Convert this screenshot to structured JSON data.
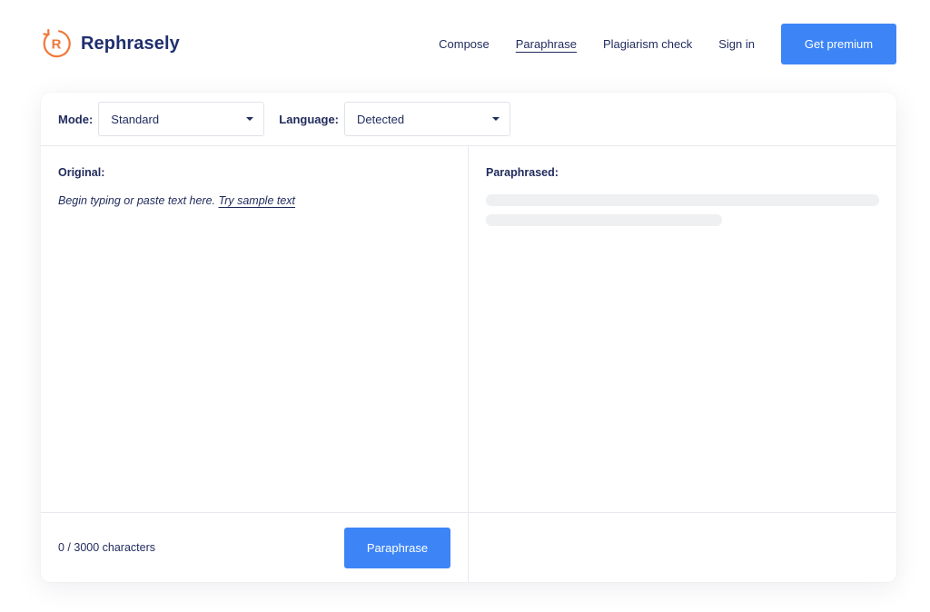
{
  "brand": {
    "name": "Rephrasely",
    "logo_letter": "R",
    "logo_color": "#f0793a",
    "color": "#1f2f6e"
  },
  "nav": {
    "compose": "Compose",
    "paraphrase": "Paraphrase",
    "plagiarism": "Plagiarism check",
    "signin": "Sign in",
    "premium": "Get premium"
  },
  "toolbar": {
    "mode_label": "Mode:",
    "mode_value": "Standard",
    "language_label": "Language:",
    "language_value": "Detected"
  },
  "original": {
    "title": "Original:",
    "placeholder": "Begin typing or paste text here.",
    "sample_link": "Try sample text"
  },
  "paraphrased": {
    "title": "Paraphrased:"
  },
  "footer": {
    "counter": "0 / 3000 characters",
    "paraphrase_button": "Paraphrase"
  },
  "colors": {
    "accent": "#3d85f6",
    "text": "#1f2a5c",
    "skeleton": "#eff0f2"
  },
  "icons": {
    "logo": "circular-arrow-R-icon",
    "caret": "caret-down-icon"
  }
}
